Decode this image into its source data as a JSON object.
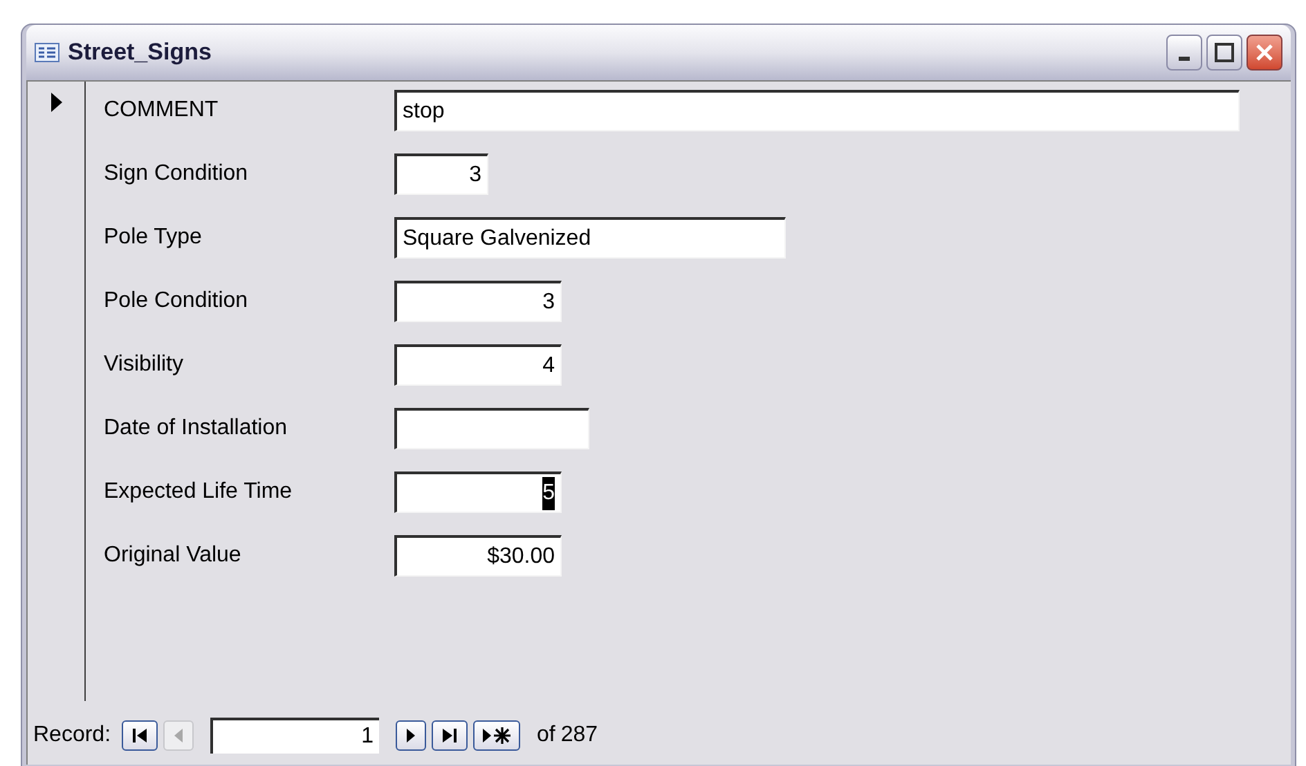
{
  "window": {
    "title": "Street_Signs"
  },
  "record_selector": {
    "current": true
  },
  "fields": [
    {
      "label": "COMMENT",
      "value": "stop",
      "kind": "text",
      "text_selected": false
    },
    {
      "label": "Sign Condition",
      "value": "3",
      "kind": "number",
      "text_selected": false
    },
    {
      "label": "Pole Type",
      "value": "Square Galvenized",
      "kind": "text",
      "text_selected": false
    },
    {
      "label": "Pole Condition",
      "value": "3",
      "kind": "number",
      "text_selected": false
    },
    {
      "label": "Visibility",
      "value": "4",
      "kind": "number",
      "text_selected": false
    },
    {
      "label": "Date of Installation",
      "kind": "number"
    },
    {
      "label": "Expected Life Time",
      "value": "5",
      "kind": "number",
      "text_selected": true
    },
    {
      "label": "Original Value",
      "value": "$30.00",
      "kind": "number",
      "text_selected": false
    }
  ],
  "navigation": {
    "label": "Record:",
    "current": "1",
    "of_text": "of",
    "total": "287",
    "buttons": [
      {
        "kind": "first",
        "disabled": false
      },
      {
        "kind": "prev",
        "disabled": true
      }
    ],
    "buttons_after": [
      {
        "kind": "next",
        "disabled": false
      },
      {
        "kind": "last",
        "disabled": false
      },
      {
        "kind": "new",
        "disabled": false
      }
    ]
  }
}
